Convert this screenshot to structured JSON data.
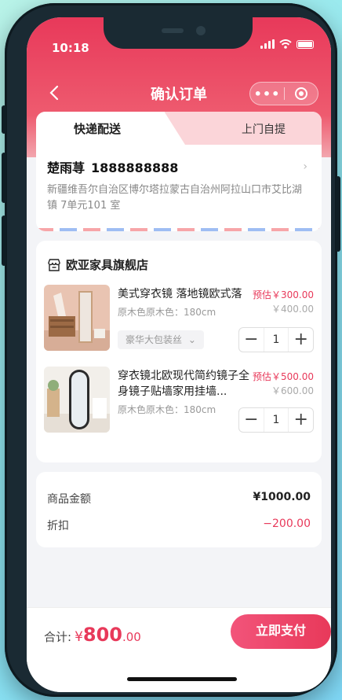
{
  "status": {
    "time": "10:18"
  },
  "nav": {
    "title": "确认订单",
    "more_glyph": "•••"
  },
  "colors": {
    "accent": "#e8395a",
    "tab_inactive_bg": "#fbd5d9"
  },
  "tabs": [
    {
      "label": "快递配送",
      "active": true
    },
    {
      "label": "上门自提",
      "active": false
    }
  ],
  "address": {
    "name": "楚雨荨",
    "phone": "1888888888",
    "detail": "新疆维吾尔自治区博尔塔拉蒙古自治州阿拉山口市艾比湖镇 7单元101 室"
  },
  "shop": {
    "name": "欧亚家具旗舰店"
  },
  "items": [
    {
      "title": "美式穿衣镜 落地镜欧式落",
      "spec": "原木色原木色：180cm",
      "price_est": "预估￥300.00",
      "price_orig": "￥400.00",
      "variant": "豪华大包装丝",
      "qty": "1"
    },
    {
      "title": "穿衣镜北欧现代简约镜子全身镜子贴墙家用挂墙...",
      "spec": "原木色原木色：180cm",
      "price_est": "预估￥500.00",
      "price_orig": "￥600.00",
      "qty": "1"
    }
  ],
  "summary": {
    "goods_label": "商品金额",
    "goods_value": "¥1000.00",
    "discount_label": "折扣",
    "discount_value": "−200.00"
  },
  "footer": {
    "total_label": "合计:",
    "currency": "¥",
    "amount_int": "800",
    "amount_dec": ".00",
    "pay_label": "立即支付"
  }
}
